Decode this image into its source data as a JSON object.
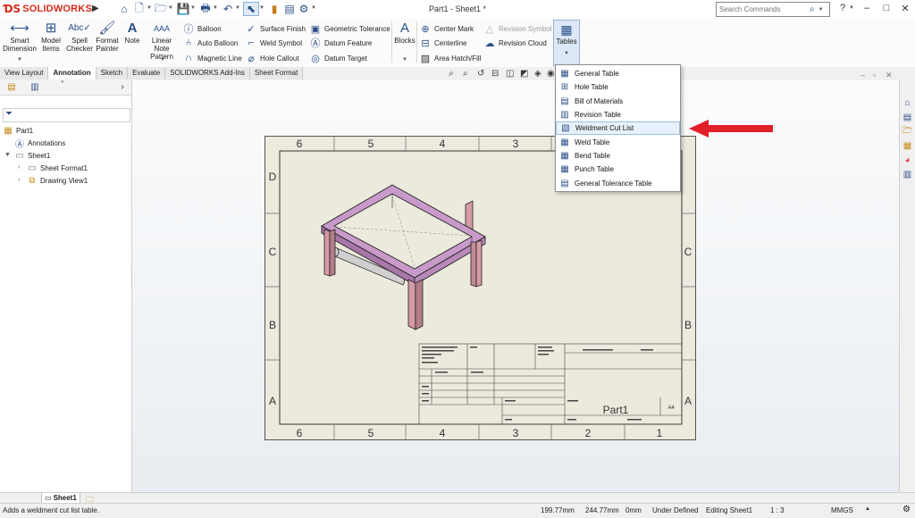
{
  "app": {
    "brand": "SOLIDWORKS",
    "doc_title": "Part1 - Sheet1 *",
    "search_placeholder": "Search Commands"
  },
  "ribbon": {
    "smart_dimension": "Smart\nDimension",
    "model_items": "Model\nItems",
    "spell_checker": "Spell\nChecker",
    "format_painter": "Format\nPainter",
    "note": "Note",
    "linear_note_pattern": "Linear Note\nPattern",
    "balloon": "Balloon",
    "auto_balloon": "Auto Balloon",
    "magnetic_line": "Magnetic Line",
    "surface_finish": "Surface Finish",
    "weld_symbol": "Weld Symbol",
    "hole_callout": "Hole Callout",
    "geometric_tolerance": "Geometric Tolerance",
    "datum_feature": "Datum Feature",
    "datum_target": "Datum Target",
    "blocks": "Blocks",
    "center_mark": "Center Mark",
    "centerline": "Centerline",
    "area_hatch": "Area Hatch/Fill",
    "revision_symbol": "Revision Symbol",
    "revision_cloud": "Revision Cloud",
    "tables": "Tables"
  },
  "tabs": [
    "View Layout",
    "Annotation",
    "Sketch",
    "Evaluate",
    "SOLIDWORKS Add-Ins",
    "Sheet Format"
  ],
  "active_tab": "Annotation",
  "tree": {
    "root": "Part1",
    "annotations": "Annotations",
    "sheet": "Sheet1",
    "sheet_format": "Sheet Format1",
    "drawing_view": "Drawing View1"
  },
  "tables_menu": [
    {
      "label": "General Table",
      "icon": "table-icon"
    },
    {
      "label": "Hole Table",
      "icon": "hole-table-icon"
    },
    {
      "label": "Bill of Materials",
      "icon": "bom-icon"
    },
    {
      "label": "Revision Table",
      "icon": "revision-table-icon"
    },
    {
      "label": "Weldment Cut List",
      "icon": "cut-list-icon"
    },
    {
      "label": "Weld Table",
      "icon": "weld-table-icon"
    },
    {
      "label": "Bend Table",
      "icon": "bend-table-icon"
    },
    {
      "label": "Punch Table",
      "icon": "punch-table-icon"
    },
    {
      "label": "General Tolerance Table",
      "icon": "tolerance-table-icon"
    }
  ],
  "highlighted_menu_item": "Weldment Cut List",
  "drawing": {
    "zone_numbers": [
      "6",
      "5",
      "4",
      "3",
      "2",
      "1"
    ],
    "zone_letters": [
      "D",
      "C",
      "B",
      "A"
    ],
    "title_block_name": "Part1",
    "sheet_size": "A4"
  },
  "sheet_tab": "Sheet1",
  "status": {
    "message": "Adds a weldment cut list table.",
    "x": "199.77mm",
    "y": "244.77mm",
    "z": "0mm",
    "state": "Under Defined",
    "editing": "Editing Sheet1",
    "scale": "1 : 3",
    "units": "MMGS"
  },
  "colors": {
    "brand_red": "#d52b1e",
    "frame_purple": "#c89ac9",
    "legs": "#d49aa5",
    "rollers": "#c9c9c9",
    "sheet_bg": "#ece9dd",
    "highlight": "#e8f1fb",
    "arrow": "#e2202a"
  }
}
